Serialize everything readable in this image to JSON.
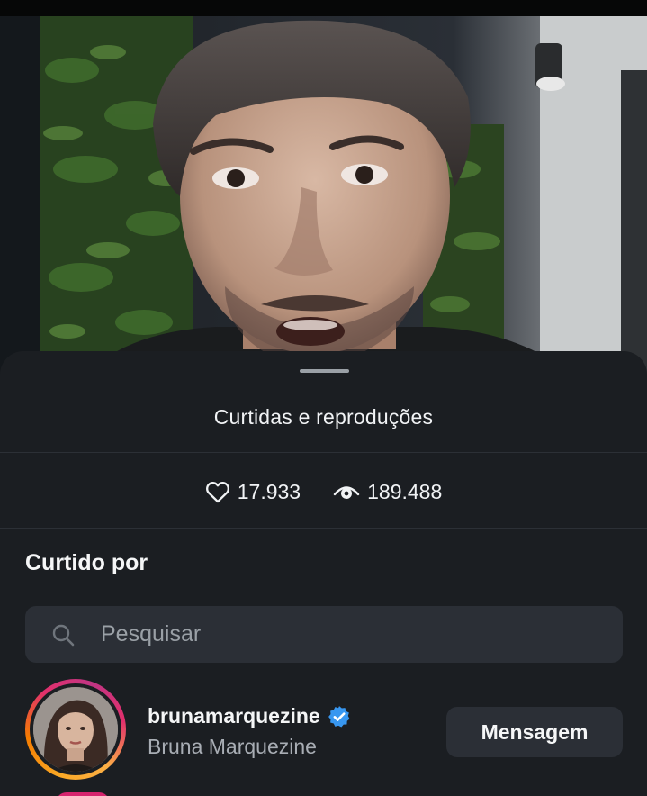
{
  "sheet": {
    "title": "Curtidas e reproduções"
  },
  "stats": {
    "likes": "17.933",
    "views": "189.488",
    "likes_icon": "heart-icon",
    "views_icon": "eye-icon"
  },
  "liked_by": {
    "title": "Curtido por",
    "search_placeholder": "Pesquisar",
    "search_value": ""
  },
  "likers": [
    {
      "username": "brunamarquezine",
      "full_name": "Bruna Marquezine",
      "verified": true,
      "action_label": "Mensagem"
    }
  ],
  "colors": {
    "sheet_bg": "#1b1e22",
    "input_bg": "#2b2f36",
    "verified_badge": "#3897f0",
    "text_primary": "#f5f6f7",
    "text_secondary": "#a8adb4"
  }
}
